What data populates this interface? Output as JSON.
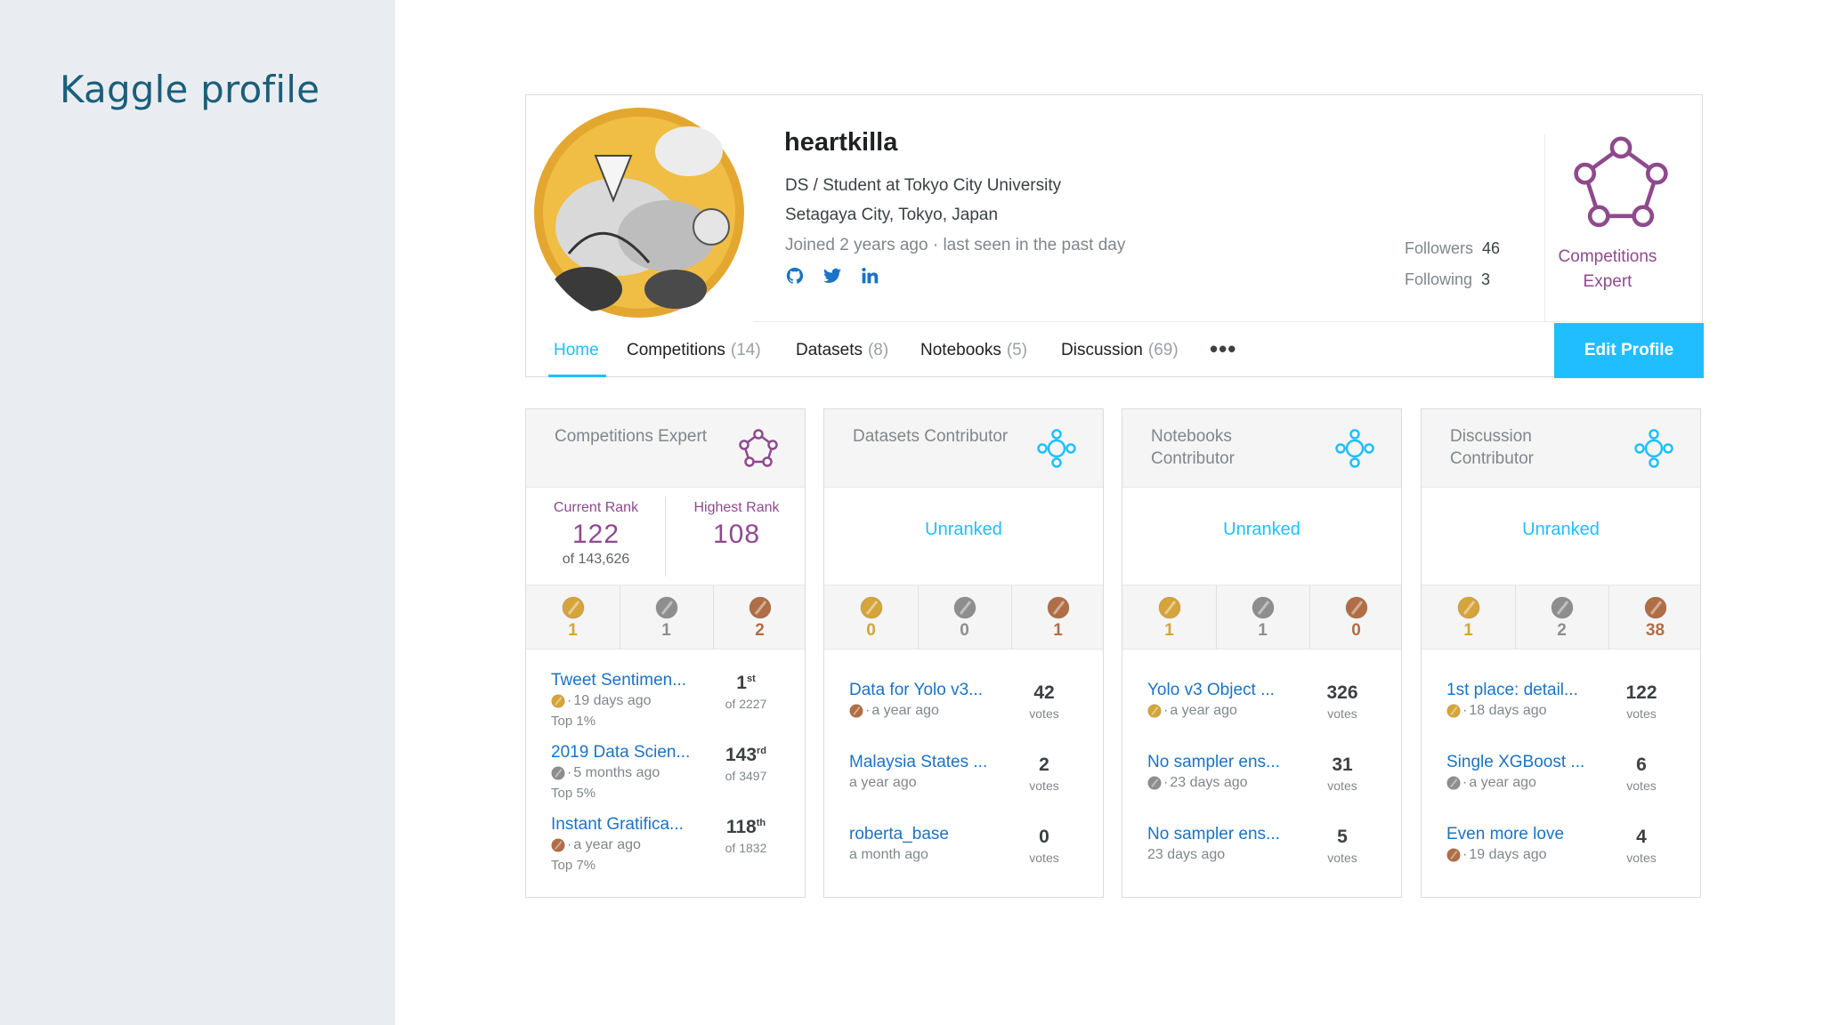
{
  "slide": {
    "title": "Kaggle profile"
  },
  "profile": {
    "username": "heartkilla",
    "bio": "DS / Student at Tokyo City University",
    "location": "Setagaya City, Tokyo, Japan",
    "joined": "Joined 2 years ago · last seen in the past day",
    "followers_label": "Followers",
    "followers": "46",
    "following_label": "Following",
    "following": "3",
    "tier": "Competitions Expert",
    "socials": [
      "github-icon",
      "twitter-icon",
      "linkedin-icon"
    ]
  },
  "tabs": [
    {
      "label": "Home",
      "count": ""
    },
    {
      "label": "Competitions",
      "count": "(14)"
    },
    {
      "label": "Datasets",
      "count": "(8)"
    },
    {
      "label": "Notebooks",
      "count": "(5)"
    },
    {
      "label": "Discussion",
      "count": "(69)"
    }
  ],
  "more_label": "•••",
  "edit_profile": "Edit Profile",
  "colors": {
    "accent": "#20beff",
    "expert": "#8e4a8c",
    "contributor": "#20beff",
    "gold": "#d5a43a",
    "silver": "#8e8e8e",
    "bronze": "#b06e46"
  },
  "categories": [
    {
      "title": "Competitions Expert",
      "current_rank_label": "Current Rank",
      "current_rank": "122",
      "of": "of 143,626",
      "highest_rank_label": "Highest Rank",
      "highest_rank": "108",
      "medals": [
        "1",
        "1",
        "2"
      ],
      "items": [
        {
          "title": "Tweet Sentimen...",
          "meta": "19 days ago",
          "medal": "gold",
          "sub": "Top 1%",
          "value": "1",
          "suffix": "st",
          "unit": "of 2227"
        },
        {
          "title": "2019 Data Scien...",
          "meta": "5 months ago",
          "medal": "silver",
          "sub": "Top 5%",
          "value": "143",
          "suffix": "rd",
          "unit": "of 3497"
        },
        {
          "title": "Instant Gratifica...",
          "meta": "a year ago",
          "medal": "bronze",
          "sub": "Top 7%",
          "value": "118",
          "suffix": "th",
          "unit": "of 1832"
        }
      ]
    },
    {
      "title": "Datasets Contributor",
      "unranked": "Unranked",
      "medals": [
        "0",
        "0",
        "1"
      ],
      "items": [
        {
          "title": "Data for Yolo v3...",
          "meta": "a year ago",
          "medal": "bronze",
          "value": "42",
          "unit": "votes"
        },
        {
          "title": "Malaysia States ...",
          "meta": "a year ago",
          "medal": "",
          "value": "2",
          "unit": "votes"
        },
        {
          "title": "roberta_base",
          "meta": "a month ago",
          "medal": "",
          "value": "0",
          "unit": "votes"
        }
      ]
    },
    {
      "title": "Notebooks Contributor",
      "unranked": "Unranked",
      "medals": [
        "1",
        "1",
        "0"
      ],
      "items": [
        {
          "title": "Yolo v3 Object ...",
          "meta": "a year ago",
          "medal": "gold",
          "value": "326",
          "unit": "votes"
        },
        {
          "title": "No sampler ens...",
          "meta": "23 days ago",
          "medal": "silver",
          "value": "31",
          "unit": "votes"
        },
        {
          "title": "No sampler ens...",
          "meta": "23 days ago",
          "medal": "",
          "value": "5",
          "unit": "votes"
        }
      ]
    },
    {
      "title": "Discussion Contributor",
      "unranked": "Unranked",
      "medals": [
        "1",
        "2",
        "38"
      ],
      "items": [
        {
          "title": "1st place: detail...",
          "meta": "18 days ago",
          "medal": "gold",
          "value": "122",
          "unit": "votes"
        },
        {
          "title": "Single XGBoost ...",
          "meta": "a year ago",
          "medal": "silver",
          "value": "6",
          "unit": "votes"
        },
        {
          "title": "Even more love",
          "meta": "19 days ago",
          "medal": "bronze",
          "value": "4",
          "unit": "votes"
        }
      ]
    }
  ]
}
